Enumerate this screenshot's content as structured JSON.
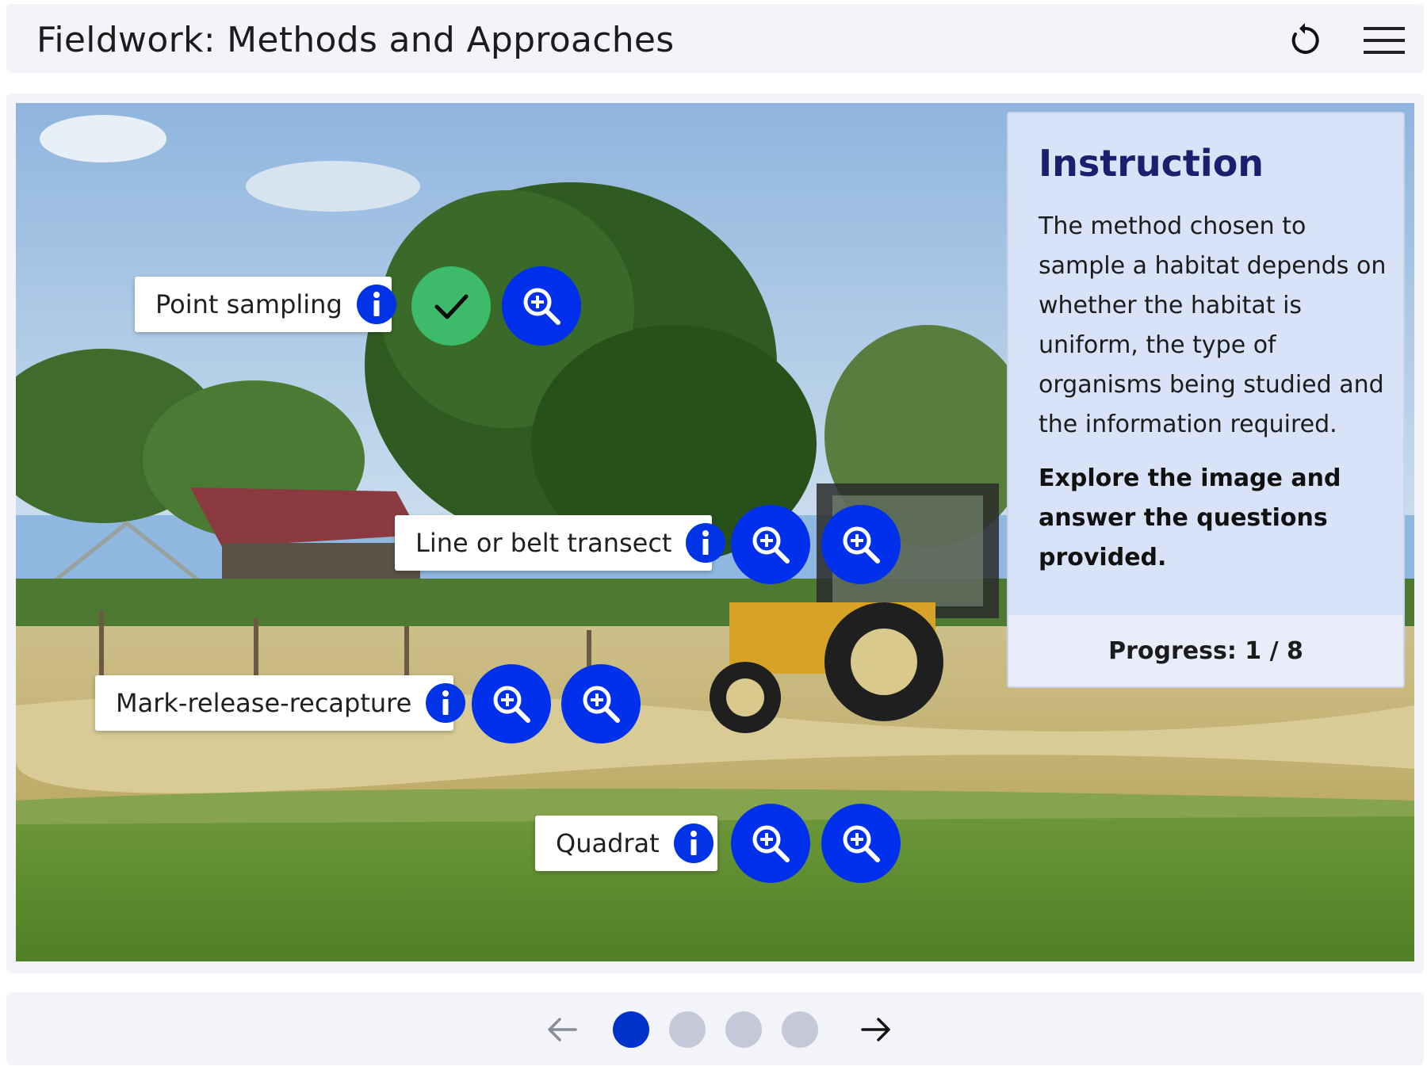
{
  "header": {
    "title": "Fieldwork: Methods and Approaches",
    "reset_icon": "reset-icon",
    "menu_icon": "hamburger-menu-icon"
  },
  "hotspots": [
    {
      "label": "Point sampling",
      "buttons": [
        "check-icon",
        "zoom-in-icon"
      ],
      "completed": true
    },
    {
      "label": "Line or belt transect",
      "buttons": [
        "zoom-in-icon",
        "zoom-in-icon"
      ],
      "completed": false
    },
    {
      "label": "Mark-release-recapture",
      "buttons": [
        "zoom-in-icon",
        "zoom-in-icon"
      ],
      "completed": false
    },
    {
      "label": "Quadrat",
      "buttons": [
        "zoom-in-icon",
        "zoom-in-icon"
      ],
      "completed": false
    }
  ],
  "instruction": {
    "title": "Instruction",
    "body": "The method chosen to sample a habitat depends on whether the habitat is uniform, the type of organisms being studied and the information required.",
    "emphasis": "Explore the image and answer the questions provided.",
    "progress": "Progress: 1 / 8"
  },
  "pagination": {
    "pages": 4,
    "current": 1,
    "prev_icon": "arrow-left-icon",
    "next_icon": "arrow-right-icon"
  },
  "colors": {
    "accent": "#0030eb",
    "completed": "#3dba6a",
    "panel_bg": "#d8e3f8",
    "panel_title": "#1d1f6e",
    "dot_active": "#0033cc",
    "dot_inactive": "#c6c8d9"
  }
}
